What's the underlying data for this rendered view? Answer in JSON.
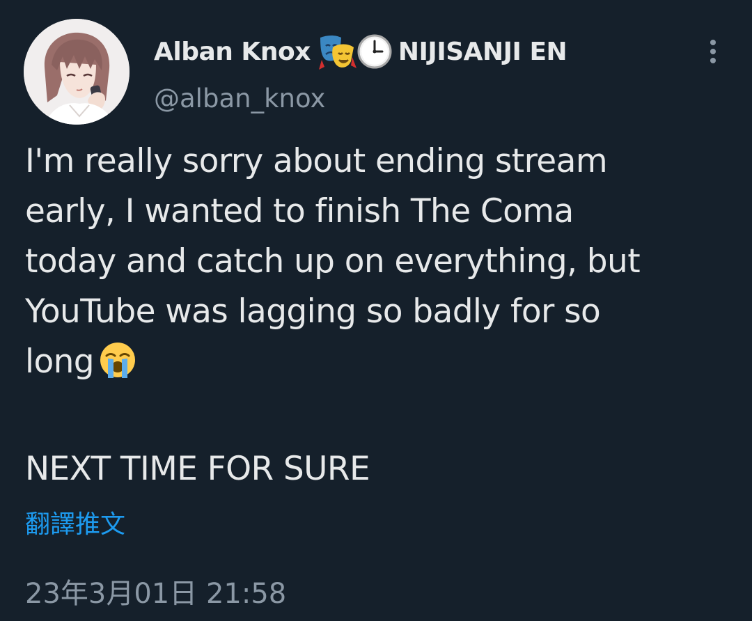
{
  "tweet": {
    "author": {
      "display_name": "Alban Knox",
      "name_icons": [
        "performing-arts-icon",
        "clock-icon"
      ],
      "name_suffix": "NIJISANJI EN",
      "handle": "@alban_knox",
      "avatar_icon": "avatar"
    },
    "more_icon": "more-options-icon",
    "text_lines": {
      "line1": "I'm really sorry about ending stream",
      "line2": "early, I wanted to finish The Coma",
      "line3": "today and catch up on everything, but",
      "line4": "YouTube was lagging so badly for so",
      "line5": "long",
      "line5_emoji": "loudly-crying-face-icon",
      "line6": "NEXT TIME FOR SURE"
    },
    "translate_label": "翻譯推文",
    "timestamp": "23年3月01日 21:58"
  },
  "colors": {
    "background": "#15202b",
    "text_primary": "#e7e9ea",
    "text_secondary": "#8b98a5",
    "link": "#1d9bf0"
  }
}
